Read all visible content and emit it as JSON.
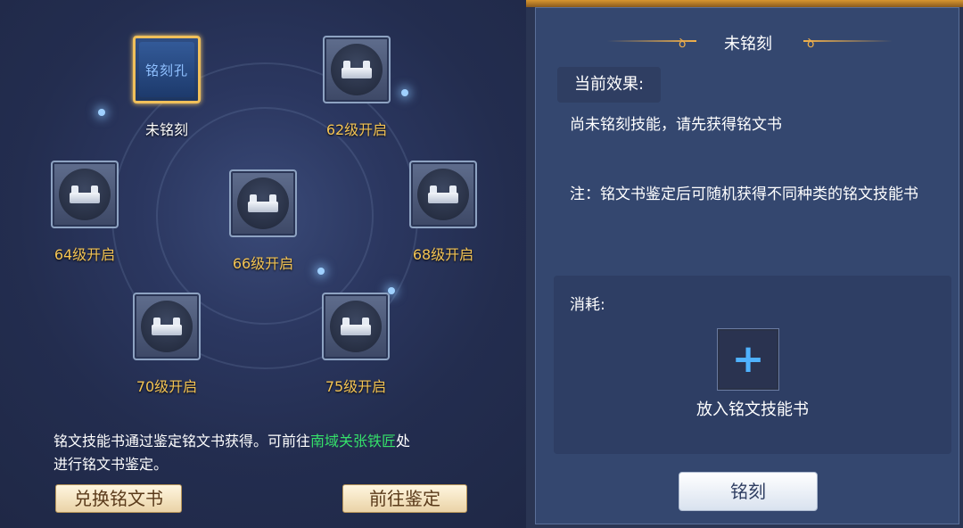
{
  "slots": {
    "hole": {
      "icon_text": "铭刻孔",
      "label": "未铭刻"
    },
    "s62": "62级开启",
    "s64": "64级开启",
    "s66": "66级开启",
    "s68": "68级开启",
    "s70": "70级开启",
    "s75": "75级开启"
  },
  "info": {
    "line1_prefix": "铭文技能书通过鉴定铭文书获得。可前往",
    "link": "南域关张铁匠",
    "line1_suffix": "处",
    "line2": "进行铭文书鉴定。"
  },
  "buttons": {
    "exchange": "兑换铭文书",
    "appraise": "前往鉴定",
    "engrave": "铭刻"
  },
  "panel": {
    "title": "未铭刻",
    "effect_tag": "当前效果:",
    "effect_text": "尚未铭刻技能，请先获得铭文书",
    "note": "注：铭文书鉴定后可随机获得不同种类的铭文技能书",
    "consume_label": "消耗:",
    "add_label": "放入铭文技能书"
  },
  "colors": {
    "gold": "#f4c454",
    "link_green": "#35e06a",
    "panel_bg": "#34476f"
  }
}
